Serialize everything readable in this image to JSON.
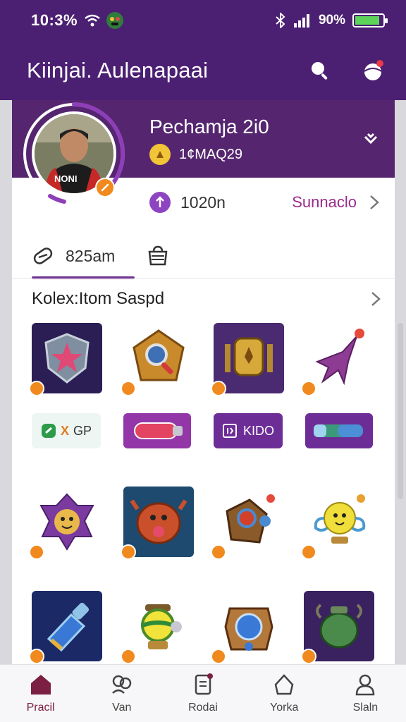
{
  "status_bar": {
    "time": "10:3%",
    "battery_label": "90%",
    "battery_level": 0.9
  },
  "app_bar": {
    "title": "Kiinjai. Aulenapaai",
    "search_icon": "search-icon",
    "notifications_icon": "notification-icon"
  },
  "profile": {
    "name": "Pechamja 2i0",
    "coins": "1¢MAQ29",
    "level": "1020n",
    "link_label": "Sunnaclo",
    "jersey_text": "NONI"
  },
  "tabs": [
    {
      "label": "825am",
      "icon": "link-icon",
      "active": true
    },
    {
      "label": "",
      "icon": "bag-icon",
      "active": false
    }
  ],
  "section": {
    "title": "Kolex:Itom Saspd"
  },
  "pills": {
    "gp_label": "GP",
    "gp_prefix": "X",
    "kido_label": "KIDO"
  },
  "bottom_nav": [
    {
      "label": "Pracil",
      "icon": "home-icon",
      "active": true
    },
    {
      "label": "Van",
      "icon": "group-icon",
      "active": false
    },
    {
      "label": "Rodai",
      "icon": "device-icon",
      "active": false
    },
    {
      "label": "Yorka",
      "icon": "house-icon",
      "active": false
    },
    {
      "label": "Slaln",
      "icon": "person-icon",
      "active": false
    }
  ],
  "colors": {
    "header": "#4b1f72",
    "card_purple": "#55266f",
    "accent": "#6b2b8e",
    "badge": "#f08a1f",
    "active_nav": "#7b2042"
  }
}
